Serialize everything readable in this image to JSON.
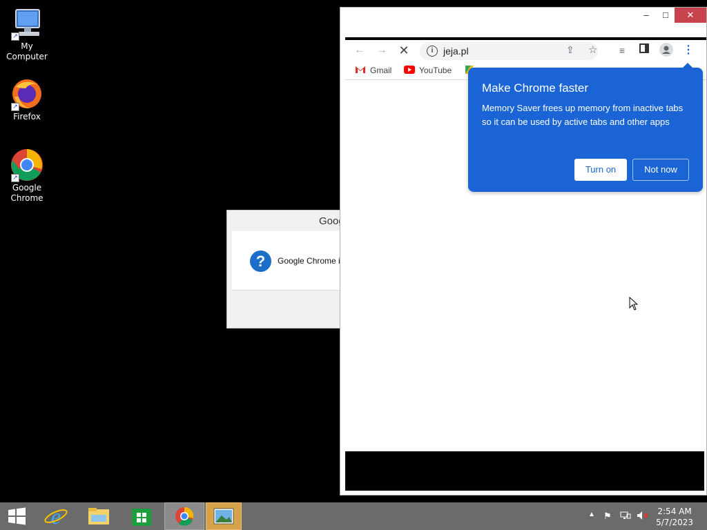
{
  "desktop": {
    "icons": [
      {
        "label": "My Computer"
      },
      {
        "label": "Firefox"
      },
      {
        "label": "Google Chrome"
      }
    ]
  },
  "dialog": {
    "title": "Goog",
    "message": "Google Chrome i"
  },
  "chrome": {
    "url": "jeja.pl",
    "bookmarks": [
      {
        "label": "Gmail"
      },
      {
        "label": "YouTube"
      }
    ],
    "window_controls": {
      "minimize": "–",
      "maximize": "□",
      "close": "✕"
    }
  },
  "promo": {
    "title": "Make Chrome faster",
    "body": "Memory Saver frees up memory from inactive tabs so it can be used by active tabs and other apps",
    "turn_on_label": "Turn on",
    "not_now_label": "Not now",
    "accent_color": "#1a64d6"
  },
  "taskbar": {
    "clock_time": "2:54 AM",
    "clock_date": "5/7/2023",
    "apps": [
      "start-icon",
      "internet-explorer-icon",
      "file-explorer-icon",
      "store-icon",
      "chrome-icon",
      "photos-icon"
    ]
  }
}
